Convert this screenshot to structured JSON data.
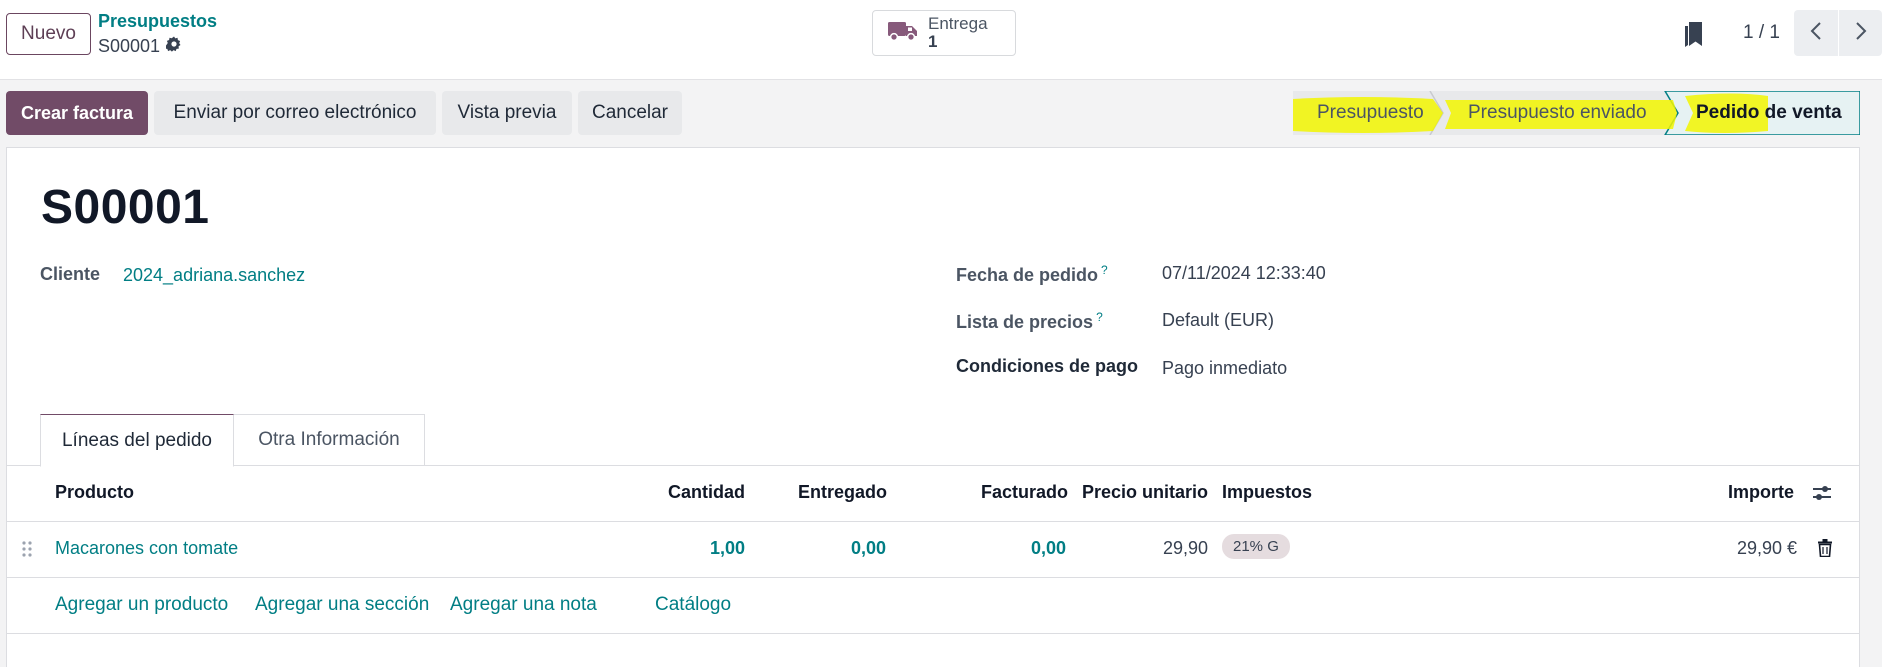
{
  "control_panel": {
    "new_button": "Nuevo",
    "breadcrumb_parent": "Presupuestos",
    "breadcrumb_current": "S00001",
    "smart_button": {
      "label": "Entrega",
      "value": "1",
      "icon": "truck-icon"
    },
    "pager_value": "1 / 1"
  },
  "actions": {
    "create_invoice": "Crear factura",
    "send_email": "Enviar por correo electrónico",
    "preview": "Vista previa",
    "cancel": "Cancelar"
  },
  "statusbar": {
    "stages": [
      "Presupuesto",
      "Presupuesto enviado",
      "Pedido de venta"
    ],
    "current": "Pedido de venta",
    "highlight_color": "#f2f600"
  },
  "form": {
    "title": "S00001",
    "customer_label": "Cliente",
    "customer_value": "2024_adriana.sanchez",
    "order_date_label": "Fecha de pedido",
    "order_date_value": "07/11/2024 12:33:40",
    "pricelist_label": "Lista de precios",
    "pricelist_value": "Default (EUR)",
    "payment_terms_label": "Condiciones de pago",
    "payment_terms_value": "Pago inmediato",
    "help_marker": "?"
  },
  "tabs": [
    "Líneas del pedido",
    "Otra Información"
  ],
  "order_lines": {
    "headers": [
      "Producto",
      "Cantidad",
      "Entregado",
      "Facturado",
      "Precio unitario",
      "Impuestos",
      "Importe"
    ],
    "rows": [
      {
        "product": "Macarones con tomate",
        "quantity": "1,00",
        "delivered": "0,00",
        "invoiced": "0,00",
        "unit_price": "29,90",
        "taxes": "21% G",
        "amount": "29,90 €"
      }
    ],
    "add_links": [
      "Agregar un producto",
      "Agregar una sección",
      "Agregar una nota",
      "Catálogo"
    ]
  },
  "colors": {
    "brand": "#714b67",
    "link": "#017e84"
  }
}
